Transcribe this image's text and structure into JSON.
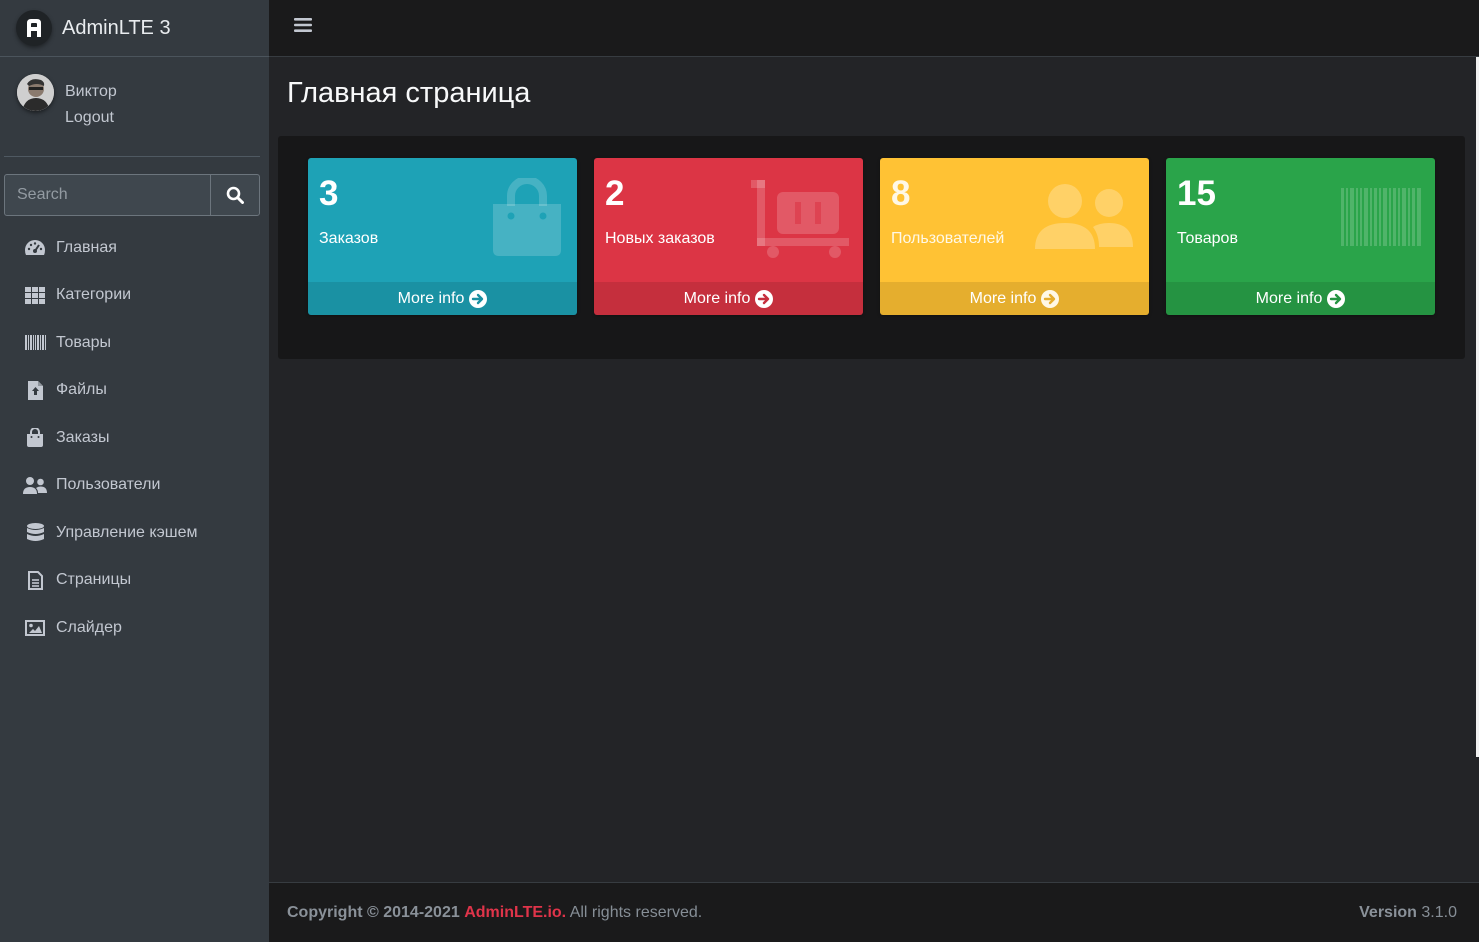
{
  "brand": {
    "title": "AdminLTE 3",
    "logo_letter": "A"
  },
  "user": {
    "name": "Виктор",
    "logout": "Logout"
  },
  "search": {
    "placeholder": "Search",
    "icon": "search-icon"
  },
  "sidebar": {
    "items": [
      {
        "label": "Главная",
        "icon": "tachometer-icon"
      },
      {
        "label": "Категории",
        "icon": "th-icon"
      },
      {
        "label": "Товары",
        "icon": "barcode-icon"
      },
      {
        "label": "Файлы",
        "icon": "file-upload-icon"
      },
      {
        "label": "Заказы",
        "icon": "shopping-bag-icon"
      },
      {
        "label": "Пользователи",
        "icon": "users-icon"
      },
      {
        "label": "Управление кэшем",
        "icon": "database-icon"
      },
      {
        "label": "Страницы",
        "icon": "file-alt-icon"
      },
      {
        "label": "Слайдер",
        "icon": "image-icon"
      }
    ]
  },
  "header": {
    "menu_icon": "bars-icon"
  },
  "main": {
    "title": "Главная страница",
    "boxes": [
      {
        "number": "3",
        "label": "Заказов",
        "more": "More info",
        "color": "#1ea2b6",
        "icon": "shopping-bag-icon"
      },
      {
        "number": "2",
        "label": "Новых заказов",
        "more": "More info",
        "color": "#dc3545",
        "icon": "dolly-icon"
      },
      {
        "number": "8",
        "label": "Пользователей",
        "more": "More info",
        "color": "#ffc234",
        "icon": "users-icon"
      },
      {
        "number": "15",
        "label": "Товаров",
        "more": "More info",
        "color": "#2aa44a",
        "icon": "barcode-icon"
      }
    ]
  },
  "footer": {
    "copyright_prefix": "Copyright © 2014-2021",
    "copyright_link": "AdminLTE.io.",
    "copyright_suffix": "All rights reserved.",
    "version_label": "Version",
    "version_value": "3.1.0"
  }
}
